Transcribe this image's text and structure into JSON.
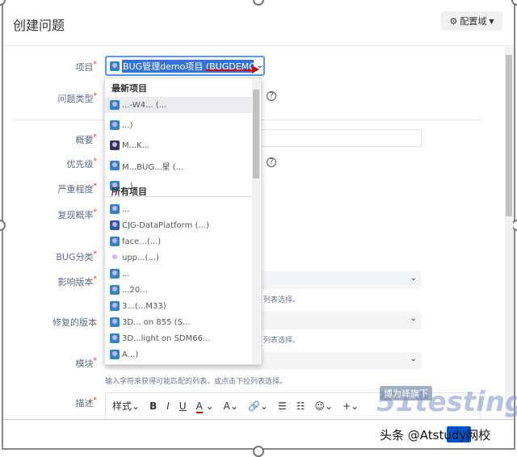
{
  "dialog": {
    "title": "创建问题",
    "config_button": "配置域"
  },
  "project": {
    "label": "项目",
    "value": "BUG管理demo项目 (BUGDEMO)"
  },
  "dropdown": {
    "recent_header": "最新项目",
    "all_header": "所有项目",
    "recent": [
      "...-W4... (...",
      "...)",
      "M...K...",
      "M...BUG...星 (...",
      "...)"
    ],
    "all": [
      "...",
      "CJG-DataPlatform (...)",
      "face...(...)",
      "upp...(...)",
      "...",
      "...20...",
      "3...(...M33)",
      "3D... on 855 (S...",
      "3D...light on SDM66...",
      "A...)"
    ]
  },
  "labels": {
    "issue_type": "问题类型",
    "summary": "概要",
    "priority": "优先级",
    "severity": "严重程度",
    "reproducibility": "复现概率",
    "bug_category": "BUG分类",
    "affects_version": "影响版本",
    "fix_version": "修复的版本",
    "module": "模块",
    "description": "描述"
  },
  "help_text": "输入字符来获得可能匹配的列表，或点击下拉列表选择。",
  "help_tail": "列表选择。",
  "toolbar": {
    "style": "样式",
    "bold": "B",
    "italic": "I",
    "underline": "U",
    "color": "A",
    "more": "A",
    "link": "🔗",
    "bullet": "☰",
    "numbered": "☷",
    "emoji": "☺",
    "insert": "+"
  },
  "watermark": {
    "tag": "博为峰旗下",
    "brand": "51testing",
    "sub": "头条 @Atstudy网校"
  }
}
